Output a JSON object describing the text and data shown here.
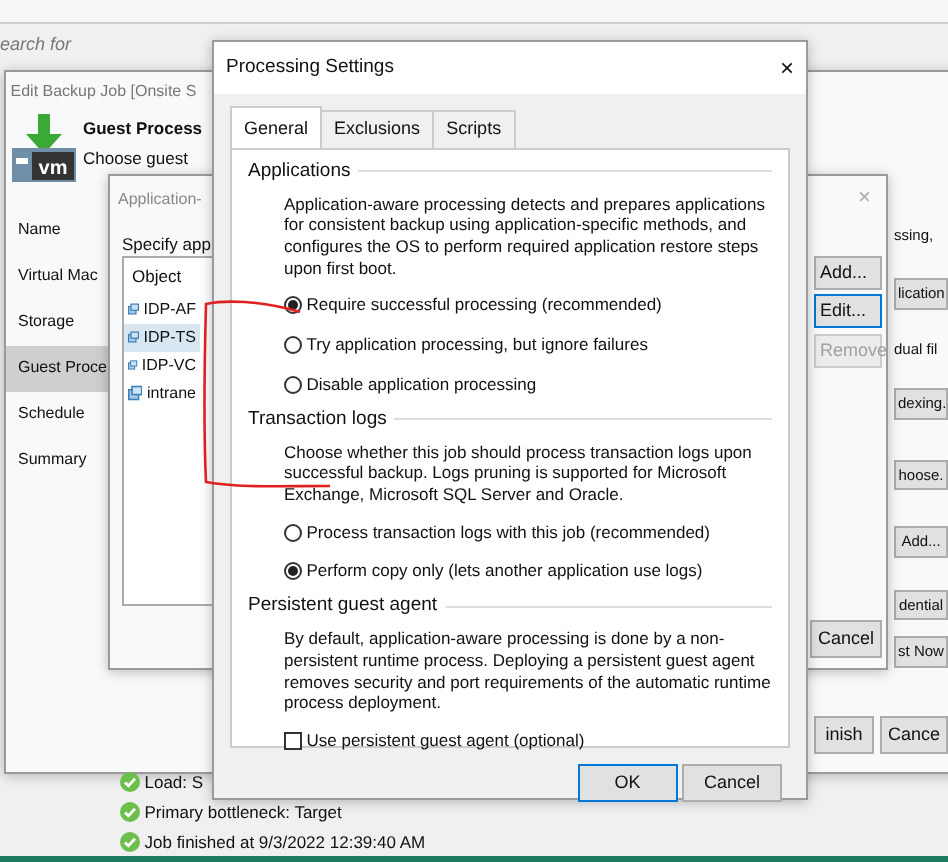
{
  "background": {
    "search_placeholder": "earch for"
  },
  "edit_job": {
    "title": "Edit Backup Job [Onsite S",
    "logo_text": "vm",
    "heading": "Guest Process",
    "subheading": "Choose guest",
    "steps": [
      {
        "label": "Name",
        "selected": false
      },
      {
        "label": "Virtual Mac",
        "selected": false
      },
      {
        "label": "Storage",
        "selected": false
      },
      {
        "label": "Guest Proce",
        "selected": true
      },
      {
        "label": "Schedule",
        "selected": false
      },
      {
        "label": "Summary",
        "selected": false
      }
    ],
    "right_items": [
      {
        "kind": "text",
        "text": "ssing,"
      },
      {
        "kind": "button",
        "text": "lication"
      },
      {
        "kind": "text",
        "text": "dual fil"
      },
      {
        "kind": "button",
        "text": "dexing."
      },
      {
        "kind": "button",
        "text": "hoose."
      },
      {
        "kind": "button",
        "text": "Add..."
      },
      {
        "kind": "button",
        "text": "dential"
      },
      {
        "kind": "button",
        "text": "st Now"
      }
    ],
    "buttons": [
      "inish",
      "Cance"
    ]
  },
  "app_window": {
    "title": "Application-",
    "close": "×",
    "instruction": "Specify app",
    "column": "Object",
    "items": [
      {
        "label": "IDP-AF",
        "selected": false
      },
      {
        "label": "IDP-TS",
        "selected": true
      },
      {
        "label": "IDP-VC",
        "selected": false
      },
      {
        "label": "intrane",
        "selected": false
      }
    ],
    "buttons": [
      {
        "label": "Add...",
        "disabled": false
      },
      {
        "label": "Edit...",
        "disabled": false
      },
      {
        "label": "Remove",
        "disabled": true
      }
    ],
    "cancel": "Cancel"
  },
  "dialog": {
    "title": "Processing Settings",
    "close": "×",
    "tabs": [
      {
        "label": "General",
        "selected": true
      },
      {
        "label": "Exclusions",
        "selected": false
      },
      {
        "label": "Scripts",
        "selected": false
      }
    ],
    "sections": [
      {
        "title": "Applications",
        "description": "Application-aware processing detects and prepares applications for consistent backup using application-specific methods, and configures the OS to perform required application restore steps upon first boot.",
        "options": [
          {
            "kind": "radio",
            "label": "Require successful processing  (recommended)",
            "selected": true
          },
          {
            "kind": "radio",
            "label": "Try application processing, but ignore failures",
            "selected": false
          },
          {
            "kind": "radio",
            "label": "Disable application processing",
            "selected": false
          }
        ]
      },
      {
        "title": "Transaction logs",
        "description": "Choose whether this job should process transaction logs upon successful backup. Logs pruning is supported for Microsoft Exchange, Microsoft SQL Server and Oracle.",
        "options": [
          {
            "kind": "radio",
            "label": "Process transaction logs with this job (recommended)",
            "selected": false
          },
          {
            "kind": "radio",
            "label": "Perform copy only (lets another application use logs)",
            "selected": true
          }
        ]
      },
      {
        "title": "Persistent guest agent",
        "description": "By default, application-aware processing is done by a non-persistent runtime process. Deploying a persistent guest agent removes security and port requirements of the automatic runtime process deployment.",
        "options": [
          {
            "kind": "checkbox",
            "label": "Use persistent guest agent (optional)",
            "checked": false
          }
        ]
      }
    ],
    "buttons": [
      "OK",
      "Cancel"
    ]
  },
  "log": [
    "Load: S",
    "Primary bottleneck: Target",
    "Job finished at 9/3/2022 12:39:40 AM"
  ]
}
